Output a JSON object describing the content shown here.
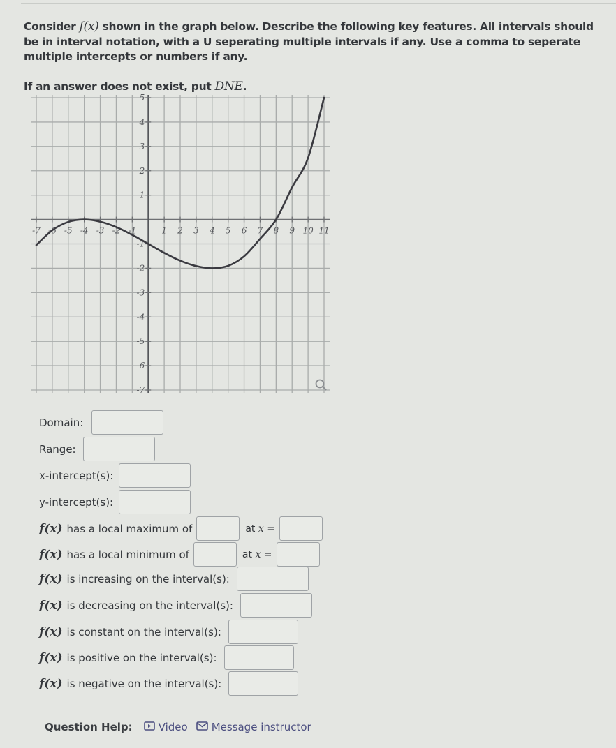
{
  "intro": {
    "prefix": "Consider ",
    "fx": "f(x)",
    "text": " shown in the graph below. Describe the following key features. All intervals should be in interval notation, with a U seperating multiple intervals if any. Use a comma to seperate multiple intercepts or numbers if any.",
    "dne_text": "If an answer does not exist, put ",
    "dne_value": "DNE",
    "dne_end": "."
  },
  "graph": {
    "x_ticks": [
      "-7",
      "-6",
      "-5",
      "-4",
      "-3",
      "-2",
      "-1",
      "1",
      "2",
      "3",
      "4",
      "5",
      "6",
      "7",
      "8",
      "9",
      "10",
      "11"
    ],
    "y_ticks": [
      "5",
      "4",
      "3",
      "2",
      "1",
      "-1",
      "-2",
      "-3",
      "-4",
      "-5",
      "-6",
      "-7"
    ],
    "zoom_icon": "magnifier-icon"
  },
  "chart_data": {
    "type": "line",
    "title": "",
    "xlabel": "",
    "ylabel": "",
    "xlim": [
      -7,
      11
    ],
    "ylim": [
      -7,
      5
    ],
    "grid": true,
    "function_description": "cubic f(x) = (x+4)^2 (x-8) / 128",
    "series": [
      {
        "name": "f(x)",
        "x": [
          -7,
          -6,
          -5,
          -4,
          -3,
          -2,
          -1,
          0,
          1,
          2,
          3,
          4,
          5,
          6,
          7,
          8,
          9,
          10,
          11
        ],
        "y": [
          -1.05,
          -0.44,
          -0.1,
          0,
          -0.09,
          -0.31,
          -0.63,
          -1.0,
          -1.37,
          -1.69,
          -1.91,
          -2.0,
          -1.9,
          -1.51,
          -0.79,
          0,
          1.32,
          2.53,
          5.0
        ]
      }
    ],
    "key_points": {
      "local_max": [
        -4,
        0
      ],
      "local_min": [
        4,
        -2
      ],
      "y_intercept": [
        0,
        -1
      ],
      "x_intercepts": [
        -4,
        8
      ],
      "start": [
        -7,
        -1
      ],
      "end": [
        11,
        5
      ]
    }
  },
  "questions": {
    "domain": "Domain:",
    "range": "Range:",
    "x_int": "x-intercept(s):",
    "y_int": "y-intercept(s):",
    "fx": "f(x)",
    "local_max": "has a local maximum of",
    "local_min": "has a local minimum of",
    "at_x": "at",
    "x_eq": "x =",
    "increasing": "is increasing on the interval(s):",
    "decreasing": "is decreasing on the interval(s):",
    "constant": "is constant on the interval(s):",
    "positive": "is positive on the interval(s):",
    "negative": "is negative on the interval(s):"
  },
  "answers": {
    "domain": "",
    "range": "",
    "x_int": "",
    "y_int": "",
    "max_val": "",
    "max_x": "",
    "min_val": "",
    "min_x": "",
    "increasing": "",
    "decreasing": "",
    "constant": "",
    "positive": "",
    "negative": ""
  },
  "help": {
    "label": "Question Help:",
    "video": "Video",
    "message": "Message instructor",
    "video_icon": "video-icon",
    "message_icon": "mail-icon"
  }
}
